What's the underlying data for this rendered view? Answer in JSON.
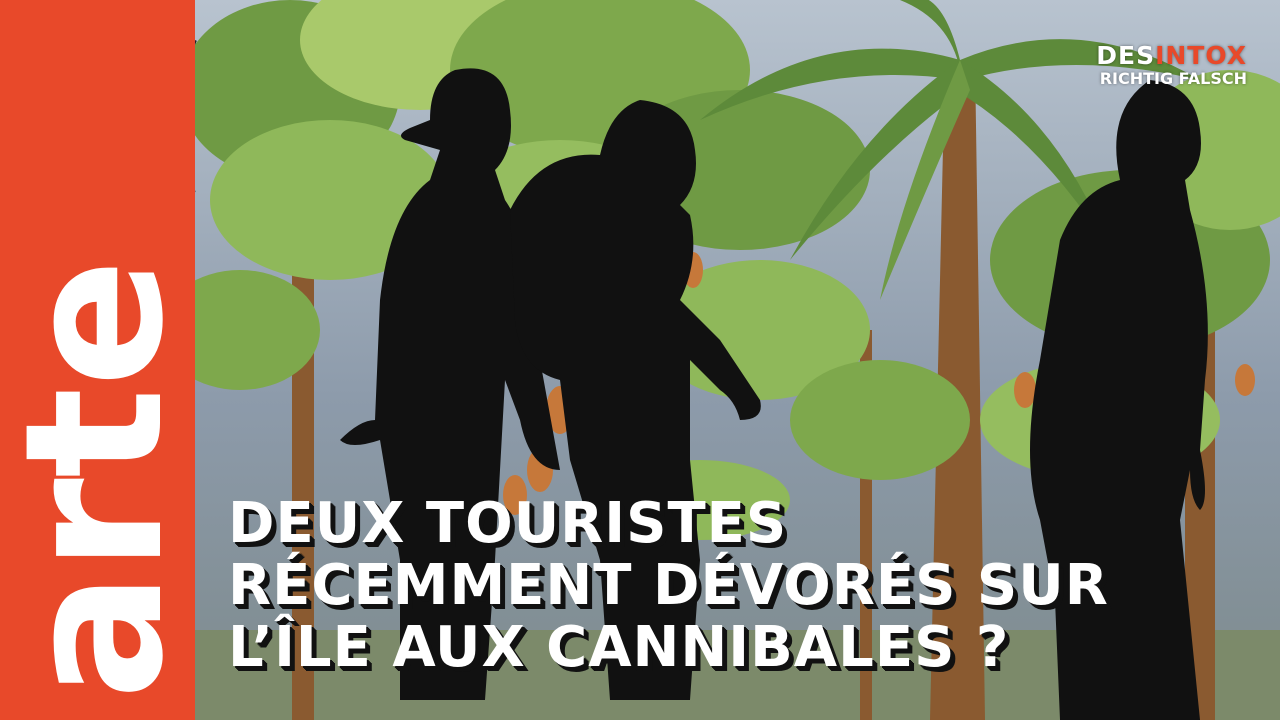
{
  "brand": {
    "logo_text": "arte"
  },
  "badge": {
    "line1_prefix": "DES",
    "line1_accent": "INTOX",
    "line2": "RICHTIG FALSCH"
  },
  "headline": {
    "lines": [
      "DEUX TOURISTES",
      "RÉCEMMENT DÉVORÉS SUR",
      "L’ÎLE AUX CANNIBALES ?"
    ]
  },
  "colors": {
    "arte_orange": "#e8492a",
    "sky": "#9aa6b4",
    "leaf_dark": "#5d8a3a",
    "leaf_light": "#a9c96b",
    "silhouette": "#111111"
  }
}
